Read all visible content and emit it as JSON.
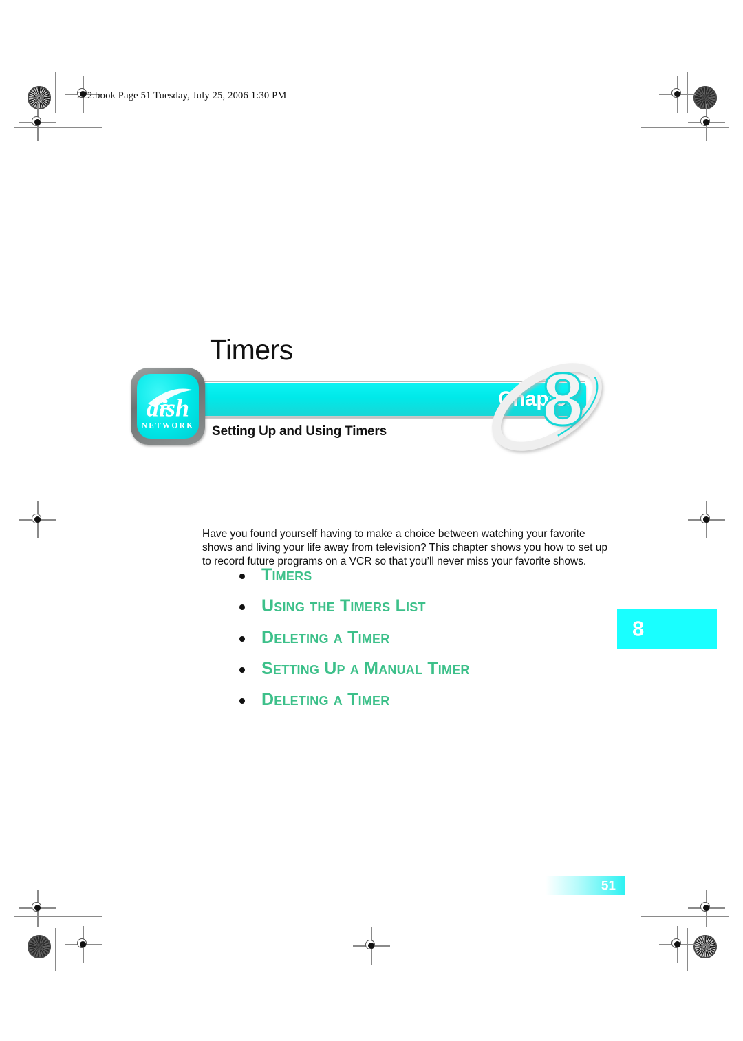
{
  "page": {
    "header_slug": "222.book  Page 51  Tuesday, July 25, 2006  1:30 PM",
    "folio_number": "51",
    "thumb_tab_number": "8"
  },
  "masthead": {
    "chapter_title": "Timers",
    "chapter_word": "Chapter",
    "chapter_number": "8",
    "subtitle": "Setting Up and Using Timers",
    "logo": {
      "wordmark": "dish",
      "tagline": "N E T W O R K"
    }
  },
  "body": {
    "intro": "Have you found yourself having to make a choice between watching your favorite shows and living your life away from television? This chapter shows you how to set up to record future programs on a VCR so that you’ll never miss your favorite shows."
  },
  "contents": {
    "items": [
      {
        "label": "Timers"
      },
      {
        "label": "Using the Timers List"
      },
      {
        "label": "Deleting a Timer"
      },
      {
        "label": "Setting Up a Manual Timer"
      },
      {
        "label": "Deleting a Timer"
      }
    ]
  },
  "colors": {
    "banner_cyan": "#00EFEF",
    "tab_cyan": "#19FFFF",
    "toc_green": "#3DC08A",
    "text_black": "#111111"
  }
}
